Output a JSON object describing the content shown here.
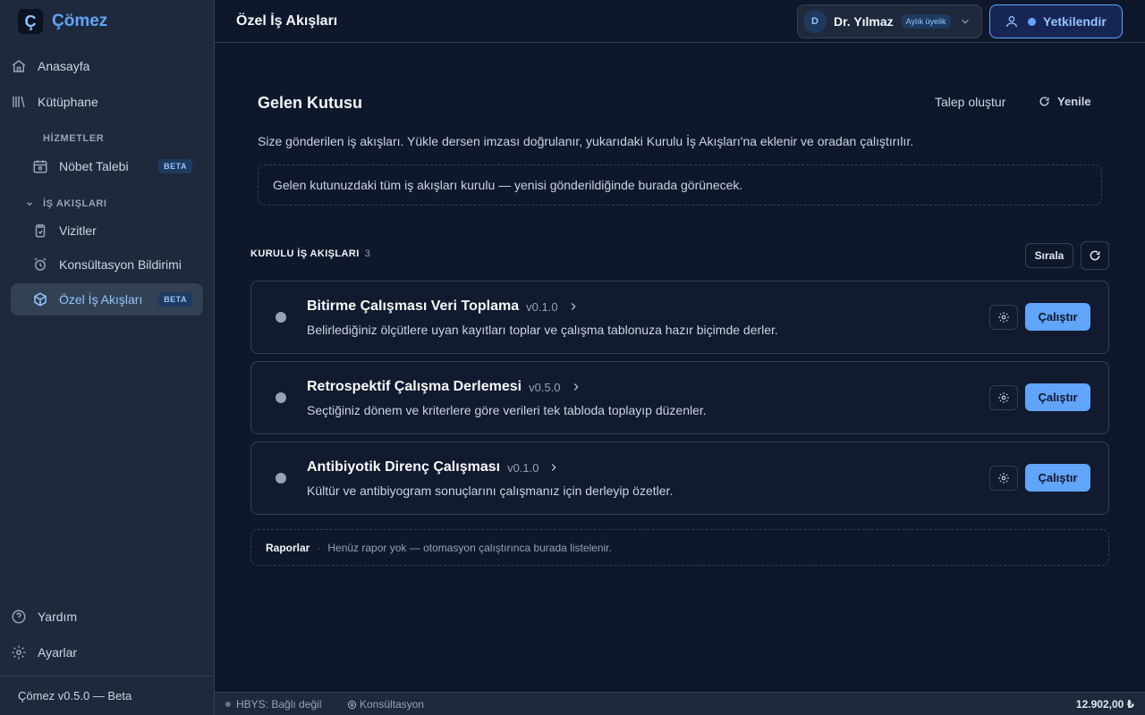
{
  "app": {
    "logo_letter": "Ç",
    "name": "Çömez",
    "version_text": "Çömez v0.5.0 — Beta"
  },
  "sidebar": {
    "home": "Anasayfa",
    "library": "Kütüphane",
    "services_title": "HİZMETLER",
    "shift_request": "Nöbet Talebi",
    "beta": "BETA",
    "workflows_title": "İŞ AKIŞLARI",
    "visits": "Vizitler",
    "consult": "Konsültasyon Bildirimi",
    "custom_workflows": "Özel İş Akışları",
    "help": "Yardım",
    "settings": "Ayarlar"
  },
  "header": {
    "title": "Özel İş Akışları",
    "user_initial": "D",
    "user_name": "Dr. Yılmaz",
    "plan": "Aylık üyelik",
    "auth_label": "Yetkilendir"
  },
  "inbox": {
    "title": "Gelen Kutusu",
    "create_request": "Talep oluştur",
    "refresh": "Yenile",
    "description": "Size gönderilen iş akışları. Yükle dersen imzası doğrulanır, yukarıdaki Kurulu İş Akışları'na eklenir ve oradan çalıştırılır.",
    "empty": "Gelen kutunuzdaki tüm iş akışları kurulu — yenisi gönderildiğinde burada görünecek."
  },
  "installed": {
    "title": "KURULU İŞ AKIŞLARI",
    "count": "3",
    "sort": "Sırala",
    "run_label": "Çalıştır",
    "items": [
      {
        "name": "Bitirme Çalışması Veri Toplama",
        "version": "v0.1.0",
        "description": "Belirlediğiniz ölçütlere uyan kayıtları toplar ve çalışma tablonuza hazır biçimde derler."
      },
      {
        "name": "Retrospektif Çalışma Derlemesi",
        "version": "v0.5.0",
        "description": "Seçtiğiniz dönem ve kriterlere göre verileri tek tabloda toplayıp düzenler."
      },
      {
        "name": "Antibiyotik Direnç Çalışması",
        "version": "v0.1.0",
        "description": "Kültür ve antibiyogram sonuçlarını çalışmanız için derleyip özetler."
      }
    ]
  },
  "reports": {
    "label": "Raporlar",
    "separator": "·",
    "text": "Henüz rapor yok — otomasyon çalıştırınca burada listelenir."
  },
  "status": {
    "hbys": "HBYS: Bağlı değil",
    "consult": "Konsültasyon",
    "total": "12.902,00 ₺"
  }
}
